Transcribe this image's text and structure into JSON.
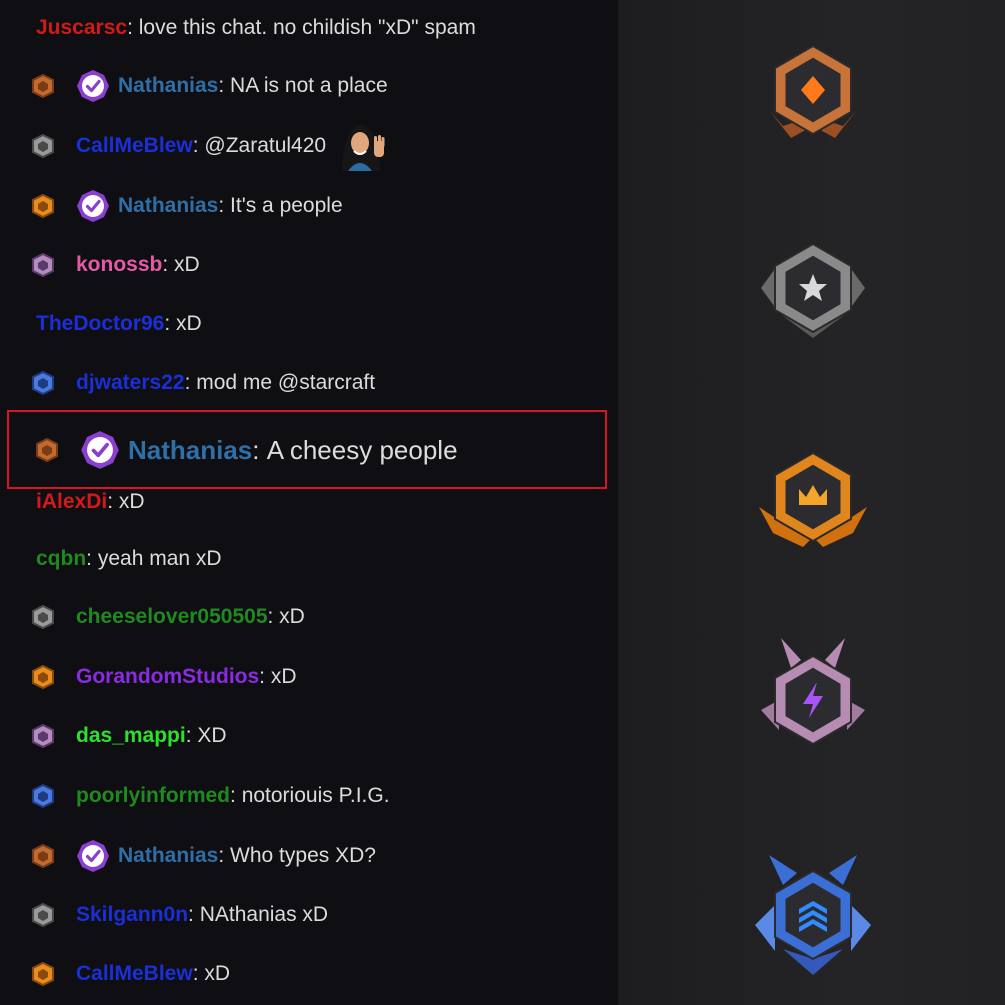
{
  "chat": {
    "messages": [
      {
        "user": "Juscarsc",
        "text": "love this chat. no childish \"xD\" spam",
        "color": "#d21a1a",
        "rank": "none",
        "verified": false
      },
      {
        "user": "Nathanias",
        "text": "NA is not a place",
        "color": "#2f6fa8",
        "rank": "bronze",
        "verified": true
      },
      {
        "user": "CallMeBlew",
        "text": "@Zaratul420",
        "color": "#1a2fd6",
        "rank": "silver",
        "verified": false,
        "emote": "waving-woman-emote"
      },
      {
        "user": "Nathanias",
        "text": "It's a people",
        "color": "#2f6fa8",
        "rank": "gold",
        "verified": true
      },
      {
        "user": "konossb",
        "text": "xD",
        "color": "#e55aa8",
        "rank": "purple",
        "verified": false
      },
      {
        "user": "TheDoctor96",
        "text": "xD",
        "color": "#1a2fd6",
        "rank": "none",
        "verified": false
      },
      {
        "user": "djwaters22",
        "text": "mod me @starcraft",
        "color": "#1a2fd6",
        "rank": "blue",
        "verified": false
      },
      {
        "user": "Nathanias",
        "text": "A cheesy people",
        "color": "#2f6fa8",
        "rank": "bronze",
        "verified": true,
        "highlighted": true
      },
      {
        "user": "iAlexDi",
        "text": "xD",
        "color": "#d21a1a",
        "rank": "none",
        "verified": false
      },
      {
        "user": "cqbn",
        "text": "yeah man xD",
        "color": "#1f8a1f",
        "rank": "none",
        "verified": false
      },
      {
        "user": "cheeselover050505",
        "text": "xD",
        "color": "#1f8a1f",
        "rank": "silver",
        "verified": false
      },
      {
        "user": "GorandomStudios",
        "text": "xD",
        "color": "#8a2be2",
        "rank": "gold",
        "verified": false
      },
      {
        "user": "das_mappi",
        "text": "XD",
        "color": "#2ee02e",
        "rank": "purple",
        "verified": false
      },
      {
        "user": "poorlyinformed",
        "text": "notoriouis P.I.G.",
        "color": "#1f8a1f",
        "rank": "blue",
        "verified": false
      },
      {
        "user": "Nathanias",
        "text": "Who types XD?",
        "color": "#2f6fa8",
        "rank": "bronze",
        "verified": true
      },
      {
        "user": "Skilgann0n",
        "text": "NAthanias xD",
        "color": "#1a2fd6",
        "rank": "silver",
        "verified": false
      },
      {
        "user": "CallMeBlew",
        "text": "xD",
        "color": "#1a2fd6",
        "rank": "gold",
        "verified": false
      }
    ],
    "separator": ": "
  },
  "sidebar": {
    "ranks": [
      {
        "name": "bronze-rank-icon",
        "symbol": "diamond",
        "color": "#c8733a"
      },
      {
        "name": "silver-rank-icon",
        "symbol": "star",
        "color": "#8a8a8a"
      },
      {
        "name": "gold-rank-icon",
        "symbol": "crown",
        "color": "#e0861c"
      },
      {
        "name": "platinum-rank-icon",
        "symbol": "lightning",
        "color": "#b78cb2"
      },
      {
        "name": "diamond-rank-icon",
        "symbol": "chevrons",
        "color": "#3b6fd6"
      }
    ]
  }
}
